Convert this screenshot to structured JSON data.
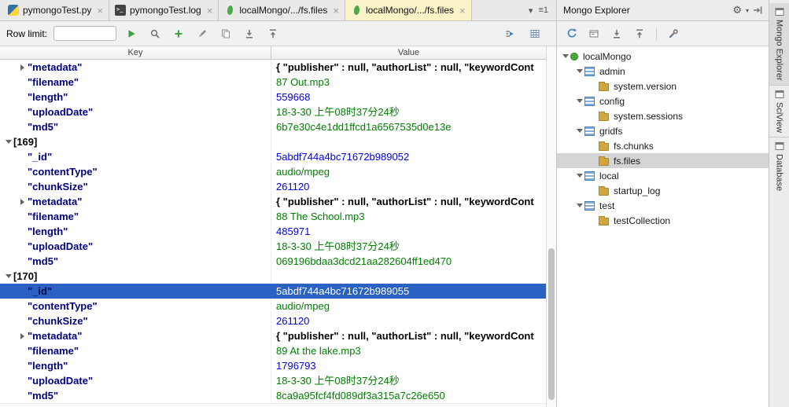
{
  "tabs": {
    "items": [
      {
        "label": "pymongoTest.py",
        "icon_class": "python",
        "icon_name": "python-file-icon",
        "state_class": ""
      },
      {
        "label": "pymongoTest.log",
        "icon_class": "terminal",
        "icon_name": "log-file-icon",
        "state_class": ""
      },
      {
        "label": "localMongo/.../fs.files",
        "icon_class": "mongo",
        "icon_name": "mongo-collection-icon",
        "state_class": ""
      },
      {
        "label": "localMongo/.../fs.files",
        "icon_class": "mongo",
        "icon_name": "mongo-collection-icon",
        "state_class": "active"
      }
    ]
  },
  "icons": {
    "close": "×",
    "tab_overflow_caret": "▾",
    "tab_list_badge": "≡1",
    "gear": "⚙",
    "gear_caret": "▾"
  },
  "editor_toolbar": {
    "row_limit_label": "Row limit:",
    "row_limit_value": ""
  },
  "table": {
    "columns": [
      "Key",
      "Value"
    ],
    "rows": [
      {
        "indent": "ind1",
        "arrow": "right",
        "key": "\"metadata\"",
        "key_class": "",
        "value": "{ \"publisher\" : null, \"authorList\" : null, \"keywordCont",
        "value_class": "v-obj",
        "row_class": ""
      },
      {
        "indent": "ind1",
        "arrow": "hid",
        "key": "\"filename\"",
        "key_class": "",
        "value": "87 Out.mp3",
        "value_class": "v-str",
        "row_class": ""
      },
      {
        "indent": "ind1",
        "arrow": "hid",
        "key": "\"length\"",
        "key_class": "",
        "value": "559668",
        "value_class": "v-num",
        "row_class": ""
      },
      {
        "indent": "ind1",
        "arrow": "hid",
        "key": "\"uploadDate\"",
        "key_class": "",
        "value": "18-3-30 上午08时37分24秒",
        "value_class": "v-str",
        "row_class": ""
      },
      {
        "indent": "ind1",
        "arrow": "hid",
        "key": "\"md5\"",
        "key_class": "",
        "value": "6b7e30c4e1dd1ffcd1a6567535d0e13e",
        "value_class": "v-str",
        "row_class": ""
      },
      {
        "indent": "ind0",
        "arrow": "down",
        "key": "[169]",
        "key_class": "k-bracket",
        "value": "",
        "value_class": "",
        "row_class": ""
      },
      {
        "indent": "ind1",
        "arrow": "hid",
        "key": "\"_id\"",
        "key_class": "",
        "value": "5abdf744a4bc71672b989052",
        "value_class": "v-num",
        "row_class": ""
      },
      {
        "indent": "ind1",
        "arrow": "hid",
        "key": "\"contentType\"",
        "key_class": "",
        "value": "audio/mpeg",
        "value_class": "v-str",
        "row_class": ""
      },
      {
        "indent": "ind1",
        "arrow": "hid",
        "key": "\"chunkSize\"",
        "key_class": "",
        "value": "261120",
        "value_class": "v-num",
        "row_class": ""
      },
      {
        "indent": "ind1",
        "arrow": "right",
        "key": "\"metadata\"",
        "key_class": "",
        "value": "{ \"publisher\" : null, \"authorList\" : null, \"keywordCont",
        "value_class": "v-obj",
        "row_class": ""
      },
      {
        "indent": "ind1",
        "arrow": "hid",
        "key": "\"filename\"",
        "key_class": "",
        "value": "88 The School.mp3",
        "value_class": "v-str",
        "row_class": ""
      },
      {
        "indent": "ind1",
        "arrow": "hid",
        "key": "\"length\"",
        "key_class": "",
        "value": "485971",
        "value_class": "v-num",
        "row_class": ""
      },
      {
        "indent": "ind1",
        "arrow": "hid",
        "key": "\"uploadDate\"",
        "key_class": "",
        "value": "18-3-30 上午08时37分24秒",
        "value_class": "v-str",
        "row_class": ""
      },
      {
        "indent": "ind1",
        "arrow": "hid",
        "key": "\"md5\"",
        "key_class": "",
        "value": "069196bdaa3dcd21aa282604ff1ed470",
        "value_class": "v-str",
        "row_class": ""
      },
      {
        "indent": "ind0",
        "arrow": "down",
        "key": "[170]",
        "key_class": "k-bracket",
        "value": "",
        "value_class": "",
        "row_class": ""
      },
      {
        "indent": "ind1",
        "arrow": "hid",
        "key": "\"_id\"",
        "key_class": "",
        "value": "5abdf744a4bc71672b989055",
        "value_class": "v-num",
        "row_class": "sel"
      },
      {
        "indent": "ind1",
        "arrow": "hid",
        "key": "\"contentType\"",
        "key_class": "",
        "value": "audio/mpeg",
        "value_class": "v-str",
        "row_class": ""
      },
      {
        "indent": "ind1",
        "arrow": "hid",
        "key": "\"chunkSize\"",
        "key_class": "",
        "value": "261120",
        "value_class": "v-num",
        "row_class": ""
      },
      {
        "indent": "ind1",
        "arrow": "right",
        "key": "\"metadata\"",
        "key_class": "",
        "value": "{ \"publisher\" : null, \"authorList\" : null, \"keywordCont",
        "value_class": "v-obj",
        "row_class": ""
      },
      {
        "indent": "ind1",
        "arrow": "hid",
        "key": "\"filename\"",
        "key_class": "",
        "value": "89 At the lake.mp3",
        "value_class": "v-str",
        "row_class": ""
      },
      {
        "indent": "ind1",
        "arrow": "hid",
        "key": "\"length\"",
        "key_class": "",
        "value": "1796793",
        "value_class": "v-num",
        "row_class": ""
      },
      {
        "indent": "ind1",
        "arrow": "hid",
        "key": "\"uploadDate\"",
        "key_class": "",
        "value": "18-3-30 上午08时37分24秒",
        "value_class": "v-str",
        "row_class": ""
      },
      {
        "indent": "ind1",
        "arrow": "hid",
        "key": "\"md5\"",
        "key_class": "",
        "value": "8ca9a95fcf4fd089df3a315a7c26e650",
        "value_class": "v-str",
        "row_class": ""
      }
    ]
  },
  "mongo_panel": {
    "title": "Mongo Explorer",
    "tree": [
      {
        "indent": "ti0",
        "chev": "down",
        "icon_class": "greendot",
        "icon_name": "mongo-server-icon",
        "label": "localMongo",
        "row_class": ""
      },
      {
        "indent": "ti1",
        "chev": "down",
        "icon_class": "dbtable",
        "icon_name": "database-icon",
        "label": "admin",
        "row_class": ""
      },
      {
        "indent": "ti2",
        "chev": "hid",
        "icon_class": "folder",
        "icon_name": "collection-folder-icon",
        "label": "system.version",
        "row_class": ""
      },
      {
        "indent": "ti1",
        "chev": "down",
        "icon_class": "dbtable",
        "icon_name": "database-icon",
        "label": "config",
        "row_class": ""
      },
      {
        "indent": "ti2",
        "chev": "hid",
        "icon_class": "folder",
        "icon_name": "collection-folder-icon",
        "label": "system.sessions",
        "row_class": ""
      },
      {
        "indent": "ti1",
        "chev": "down",
        "icon_class": "dbtable",
        "icon_name": "database-icon",
        "label": "gridfs",
        "row_class": ""
      },
      {
        "indent": "ti2",
        "chev": "hid",
        "icon_class": "folder",
        "icon_name": "collection-folder-icon",
        "label": "fs.chunks",
        "row_class": ""
      },
      {
        "indent": "ti2",
        "chev": "hid",
        "icon_class": "folder",
        "icon_name": "collection-folder-icon",
        "label": "fs.files",
        "row_class": "sel"
      },
      {
        "indent": "ti1",
        "chev": "down",
        "icon_class": "dbtable",
        "icon_name": "database-icon",
        "label": "local",
        "row_class": ""
      },
      {
        "indent": "ti2",
        "chev": "hid",
        "icon_class": "folder",
        "icon_name": "collection-folder-icon",
        "label": "startup_log",
        "row_class": ""
      },
      {
        "indent": "ti1",
        "chev": "down",
        "icon_class": "dbtable",
        "icon_name": "database-icon",
        "label": "test",
        "row_class": ""
      },
      {
        "indent": "ti2",
        "chev": "hid",
        "icon_class": "folder",
        "icon_name": "collection-folder-icon",
        "label": "testCollection",
        "row_class": ""
      }
    ]
  },
  "right_strip": {
    "buttons": [
      {
        "label": "Mongo Explorer",
        "state_class": "active"
      },
      {
        "label": "SciView",
        "state_class": ""
      },
      {
        "label": "Database",
        "state_class": ""
      }
    ]
  }
}
